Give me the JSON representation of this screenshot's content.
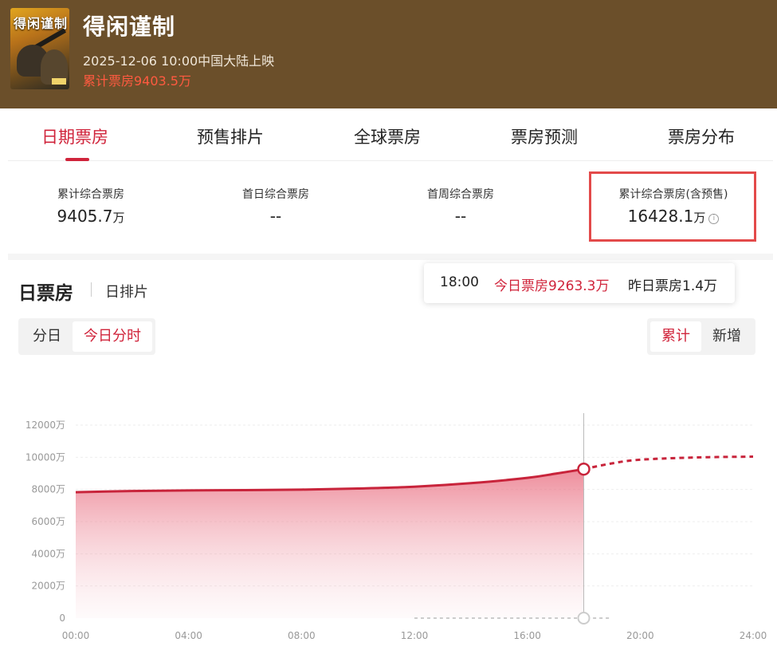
{
  "movie": {
    "poster_text": "得闲谨制",
    "title": "得闲谨制",
    "release": "2025-12-06 10:00中国大陆上映",
    "cumulative": "累计票房9403.5万"
  },
  "tabs": [
    {
      "label": "日期票房",
      "active": true
    },
    {
      "label": "预售排片",
      "active": false
    },
    {
      "label": "全球票房",
      "active": false
    },
    {
      "label": "票房预测",
      "active": false
    },
    {
      "label": "票房分布",
      "active": false
    }
  ],
  "stats": [
    {
      "label": "累计综合票房",
      "value": "9405.7",
      "unit": "万"
    },
    {
      "label": "首日综合票房",
      "value": "--",
      "unit": ""
    },
    {
      "label": "首周综合票房",
      "value": "--",
      "unit": ""
    },
    {
      "label": "累计综合票房(含预售)",
      "value": "16428.1",
      "unit": "万",
      "info_icon": "info-icon"
    }
  ],
  "section": {
    "title": "日票房",
    "subtitle": "日排片"
  },
  "toggle_left": {
    "options": [
      "分日",
      "今日分时"
    ],
    "selected": "今日分时"
  },
  "toggle_right": {
    "options": [
      "累计",
      "新增"
    ],
    "selected": "累计"
  },
  "tooltip": {
    "time": "18:00",
    "today": "今日票房9263.3万",
    "yesterday": "昨日票房1.4万"
  },
  "colors": {
    "accent": "#d0243b",
    "header_bg": "#6b4f2a",
    "highlight_border": "#e34a4a"
  },
  "chart_data": {
    "type": "area",
    "x_labels": [
      "00:00",
      "04:00",
      "08:00",
      "12:00",
      "16:00",
      "20:00",
      "24:00"
    ],
    "y_ticks": [
      "0",
      "2000万",
      "4000万",
      "6000万",
      "8000万",
      "10000万",
      "12000万"
    ],
    "ylim": [
      0,
      12000
    ],
    "xlim": [
      0,
      24
    ],
    "grid": true,
    "series": [
      {
        "values": [
          [
            0,
            7830
          ],
          [
            2,
            7900
          ],
          [
            4,
            7940
          ],
          [
            6,
            7960
          ],
          [
            8,
            7990
          ],
          [
            10,
            8060
          ],
          [
            12,
            8170
          ],
          [
            14,
            8390
          ],
          [
            16,
            8720
          ],
          [
            17,
            8980
          ],
          [
            18,
            9263.3
          ]
        ],
        "style": "solid-area"
      },
      {
        "values": [
          [
            18,
            9263.3
          ],
          [
            19,
            9620
          ],
          [
            20,
            9850
          ],
          [
            22,
            9990
          ],
          [
            24,
            10040
          ]
        ],
        "style": "dashed"
      },
      {
        "values": [
          [
            12,
            0
          ],
          [
            18,
            0
          ],
          [
            19,
            0
          ]
        ],
        "style": "dashed-gray"
      }
    ],
    "marker": {
      "x": 18,
      "y": 9263.3
    }
  }
}
